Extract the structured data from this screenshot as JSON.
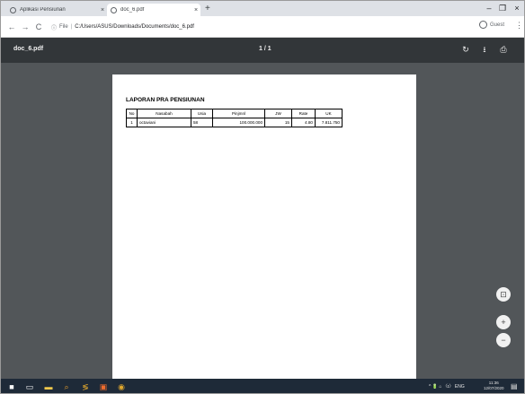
{
  "tabs": [
    {
      "title": "Aplikasi Pensiunan",
      "close": "×"
    },
    {
      "title": "doc_6.pdf",
      "close": "×"
    }
  ],
  "new_tab": "+",
  "window_controls": {
    "minimize": "–",
    "maximize": "❐",
    "close": "×"
  },
  "nav": {
    "back": "←",
    "forward": "→",
    "reload": "C"
  },
  "address": {
    "scheme_label": "File",
    "url": "C:/Users/ASUS/Downloads/Documents/doc_6.pdf"
  },
  "profile": {
    "label": "Guest"
  },
  "pdf": {
    "filename": "doc_6.pdf",
    "page_indicator": "1 / 1"
  },
  "report": {
    "title": "LAPORAN PRA PENSIUNAN",
    "columns": [
      "No",
      "Nasabah",
      "Usia",
      "Pinjmnl",
      "JW",
      "Rate",
      "UK"
    ],
    "rows": [
      [
        "1",
        "octaviani",
        "58",
        "100.000.000",
        "15",
        "4.80",
        "7.811.750"
      ]
    ]
  },
  "taskbar": {
    "tray_text": "^ 🔋 ⌂ 〈ɪ〉 ENG",
    "time": "11:36",
    "date": "12/07/2020"
  }
}
